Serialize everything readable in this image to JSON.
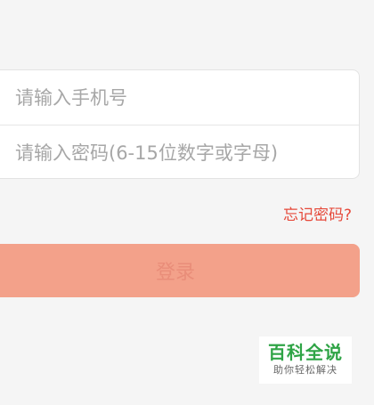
{
  "form": {
    "phone_placeholder": "请输入手机号",
    "password_placeholder": "请输入密码(6-15位数字或字母)",
    "forgot_password": "忘记密码?",
    "login_label": "登录"
  },
  "watermark": {
    "title": "百科全说",
    "subtitle": "助你轻松解决"
  },
  "colors": {
    "background": "#f5f5f5",
    "accent": "#e64a3b",
    "login_button": "#f3a18a",
    "watermark_green": "#2fa446"
  }
}
